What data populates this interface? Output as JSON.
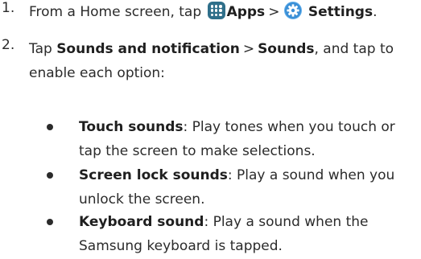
{
  "steps": [
    {
      "number": "1.",
      "text_1": "From a Home screen, tap",
      "apps_label": "Apps",
      "separator": ">",
      "settings_label": "Settings",
      "end": "."
    },
    {
      "number": "2.",
      "text_1": "Tap",
      "sounds_notification_label": "Sounds and notification",
      "separator": ">",
      "sounds_label": "Sounds",
      "text_2": ", and tap to enable each option:"
    }
  ],
  "options": [
    {
      "name": "Touch sounds",
      "description": ": Play tones when you touch or tap the screen to make selections."
    },
    {
      "name": "Screen lock sounds",
      "description": ": Play a sound when you unlock the screen."
    },
    {
      "name": "Keyboard sound",
      "description": ": Play a sound when the Samsung keyboard is tapped."
    }
  ],
  "icons": {
    "apps": "apps-grid-icon",
    "settings": "settings-gear-icon"
  },
  "colors": {
    "apps_icon": "#2f6f8a",
    "settings_icon": "#3a8fd6"
  }
}
